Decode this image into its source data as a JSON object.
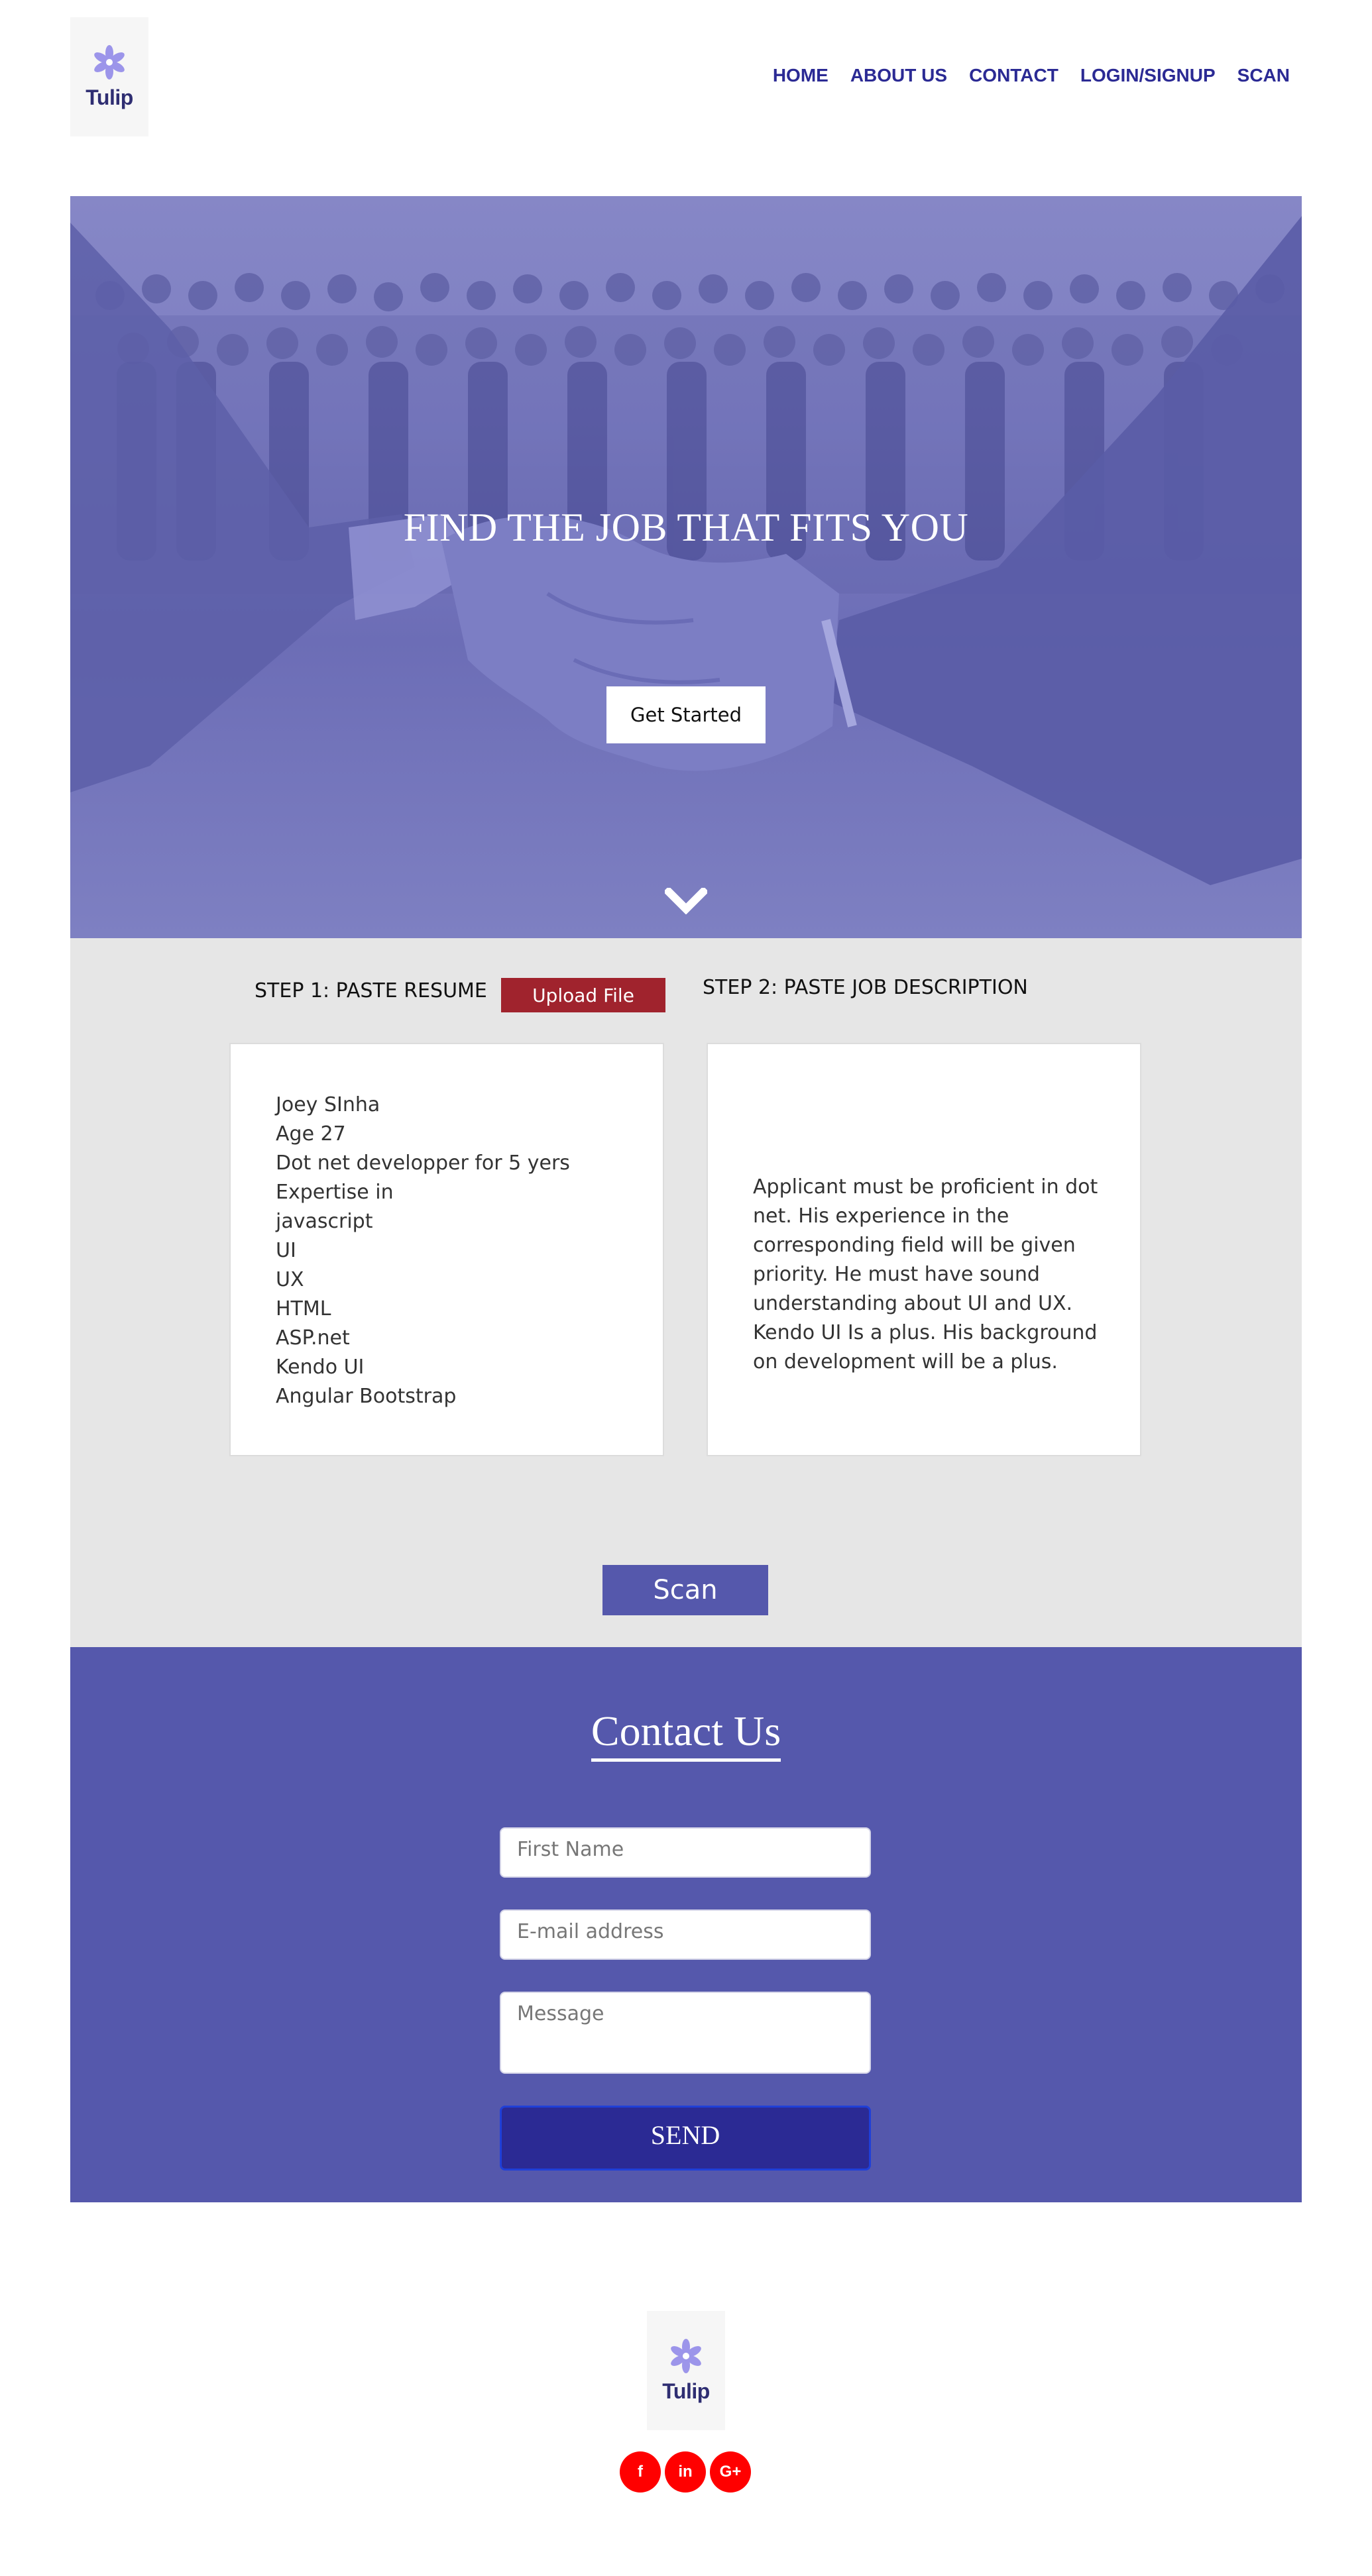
{
  "brand": {
    "logo_text": "Tulip"
  },
  "nav": {
    "items": [
      "HOME",
      "ABOUT US",
      "CONTACT",
      "LOGIN/SIGNUP",
      "SCAN"
    ]
  },
  "hero": {
    "title": "FIND THE JOB THAT FITS YOU",
    "cta_label": "Get Started",
    "scroll_icon": "chevron-down-icon"
  },
  "steps": {
    "step1_label": "STEP 1: PASTE RESUME",
    "upload_label": "Upload File",
    "step2_label": "STEP 2: PASTE JOB DESCRIPTION",
    "resume_lines": [
      "Joey SInha",
      "Age 27",
      "Dot net developper for 5 yers",
      "Expertise in",
      "javascript",
      "UI",
      "UX",
      "HTML",
      "ASP.net",
      "Kendo UI",
      "Angular Bootstrap"
    ],
    "job_description": "Applicant must be proficient in dot net. His experience in the corresponding field will be given priority. He must have sound understanding about UI and UX. Kendo UI Is a plus. His background on development will be a plus.",
    "scan_label": "Scan"
  },
  "contact": {
    "title": "Contact Us",
    "first_name_placeholder": "First Name",
    "email_placeholder": "E-mail address",
    "message_placeholder": "Message",
    "send_label": "SEND"
  },
  "footer": {
    "social": [
      {
        "icon": "facebook-icon",
        "glyph": "f"
      },
      {
        "icon": "linkedin-icon",
        "glyph": "in"
      },
      {
        "icon": "google-plus-icon",
        "glyph": "G+"
      }
    ]
  },
  "colors": {
    "primary": "#5558ac",
    "nav_text": "#2b2a94",
    "upload_button": "#a0232d",
    "social_button": "#ff0000",
    "section_bg": "#e6e6e6"
  }
}
